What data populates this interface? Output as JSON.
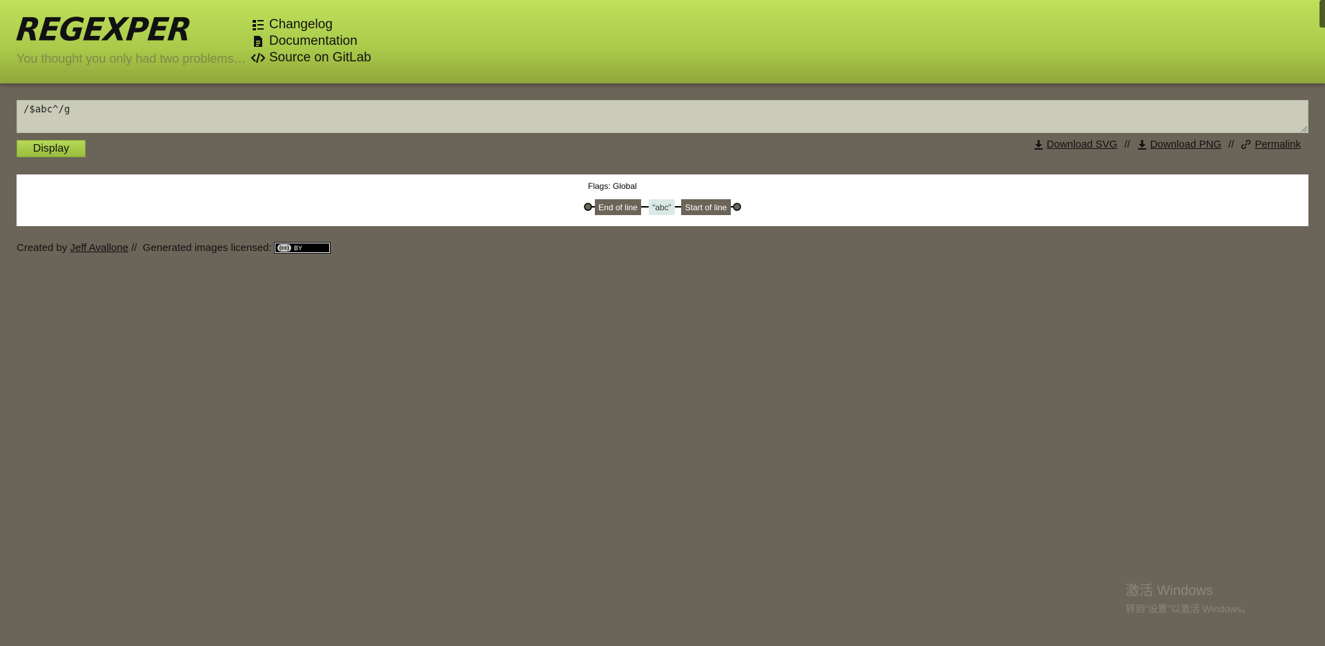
{
  "header": {
    "logo": "REGEXPER",
    "tagline": "You thought you only had two problems…",
    "nav": [
      {
        "label": "Changelog",
        "icon": "list-icon"
      },
      {
        "label": "Documentation",
        "icon": "document-icon"
      },
      {
        "label": "Source on GitLab",
        "icon": "code-icon"
      }
    ]
  },
  "input": {
    "value": "/$abc^/g"
  },
  "display_button": "Display",
  "actions": {
    "download_svg": "Download SVG",
    "download_png": "Download PNG",
    "permalink": "Permalink",
    "separator": "//"
  },
  "diagram": {
    "flags": "Flags: Global",
    "nodes": [
      {
        "label": "End of line",
        "kind": "anchor"
      },
      {
        "label": "“abc”",
        "kind": "literal"
      },
      {
        "label": "Start of line",
        "kind": "anchor"
      }
    ]
  },
  "footer": {
    "created_by": "Created by",
    "author": "Jeff Avallone",
    "separator": "//",
    "license_text": "Generated images licensed:",
    "badge_cc": "(cc)",
    "badge_by": "BY"
  },
  "watermark": {
    "title": "激活 Windows",
    "subtitle": "转到“设置”以激活 Windows。"
  },
  "colors": {
    "background": "#6b6458",
    "header_green": "#b5d654",
    "anchor_box": "#6b6458",
    "literal_box": "#dae9e5"
  }
}
